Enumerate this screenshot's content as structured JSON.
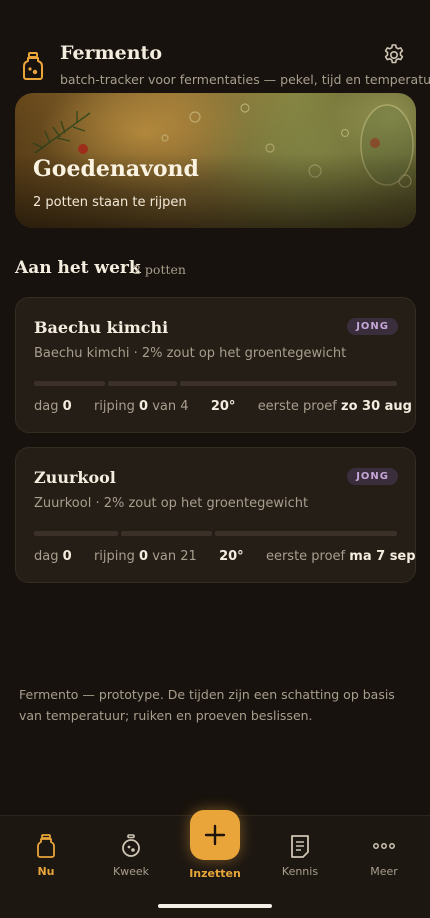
{
  "header": {
    "title": "Fermento",
    "subtitle": "batch-tracker voor fermentaties — pekel, tijd en temperatuur",
    "logo_icon": "jar-icon",
    "settings_icon": "gear-icon"
  },
  "hero": {
    "title": "Goedenavond",
    "subtitle": "2 potten staan te rijpen"
  },
  "section": {
    "title": "Aan het werk",
    "count": "2 potten"
  },
  "batches": [
    {
      "name": "Baechu kimchi",
      "badge": "JONG",
      "description": "Baechu kimchi · 2% zout op het groentegewicht",
      "day_label": "dag",
      "day": "0",
      "ripening_label": "rijping",
      "ripening": "0",
      "ripening_of": "van 4",
      "temperature": "20°",
      "first_taste_label": "eerste proef",
      "first_taste": "zo 30 aug",
      "progress": 0
    },
    {
      "name": "Zuurkool",
      "badge": "JONG",
      "description": "Zuurkool · 2% zout op het groentegewicht",
      "day_label": "dag",
      "day": "0",
      "ripening_label": "rijping",
      "ripening": "0",
      "ripening_of": "van 21",
      "temperature": "20°",
      "first_taste_label": "eerste proef",
      "first_taste": "ma 7 sep",
      "progress": 0
    }
  ],
  "footnote": "Fermento — prototype. De tijden zijn een schatting op basis van temperatuur; ruiken en proeven beslissen.",
  "nav": {
    "items": [
      {
        "label": "Nu",
        "icon": "jar-icon",
        "active": true
      },
      {
        "label": "Kweek",
        "icon": "timer-icon",
        "active": false
      },
      {
        "label": "Inzetten",
        "icon": "plus-icon",
        "active": false
      },
      {
        "label": "Kennis",
        "icon": "notes-icon",
        "active": false
      },
      {
        "label": "Meer",
        "icon": "more-icon",
        "active": false
      }
    ]
  },
  "colors": {
    "background": "#17120d",
    "card": "#251e17",
    "accent": "#e9a53a",
    "badge_text": "#c6a6d8",
    "badge_bg": "#3a2e3d"
  }
}
